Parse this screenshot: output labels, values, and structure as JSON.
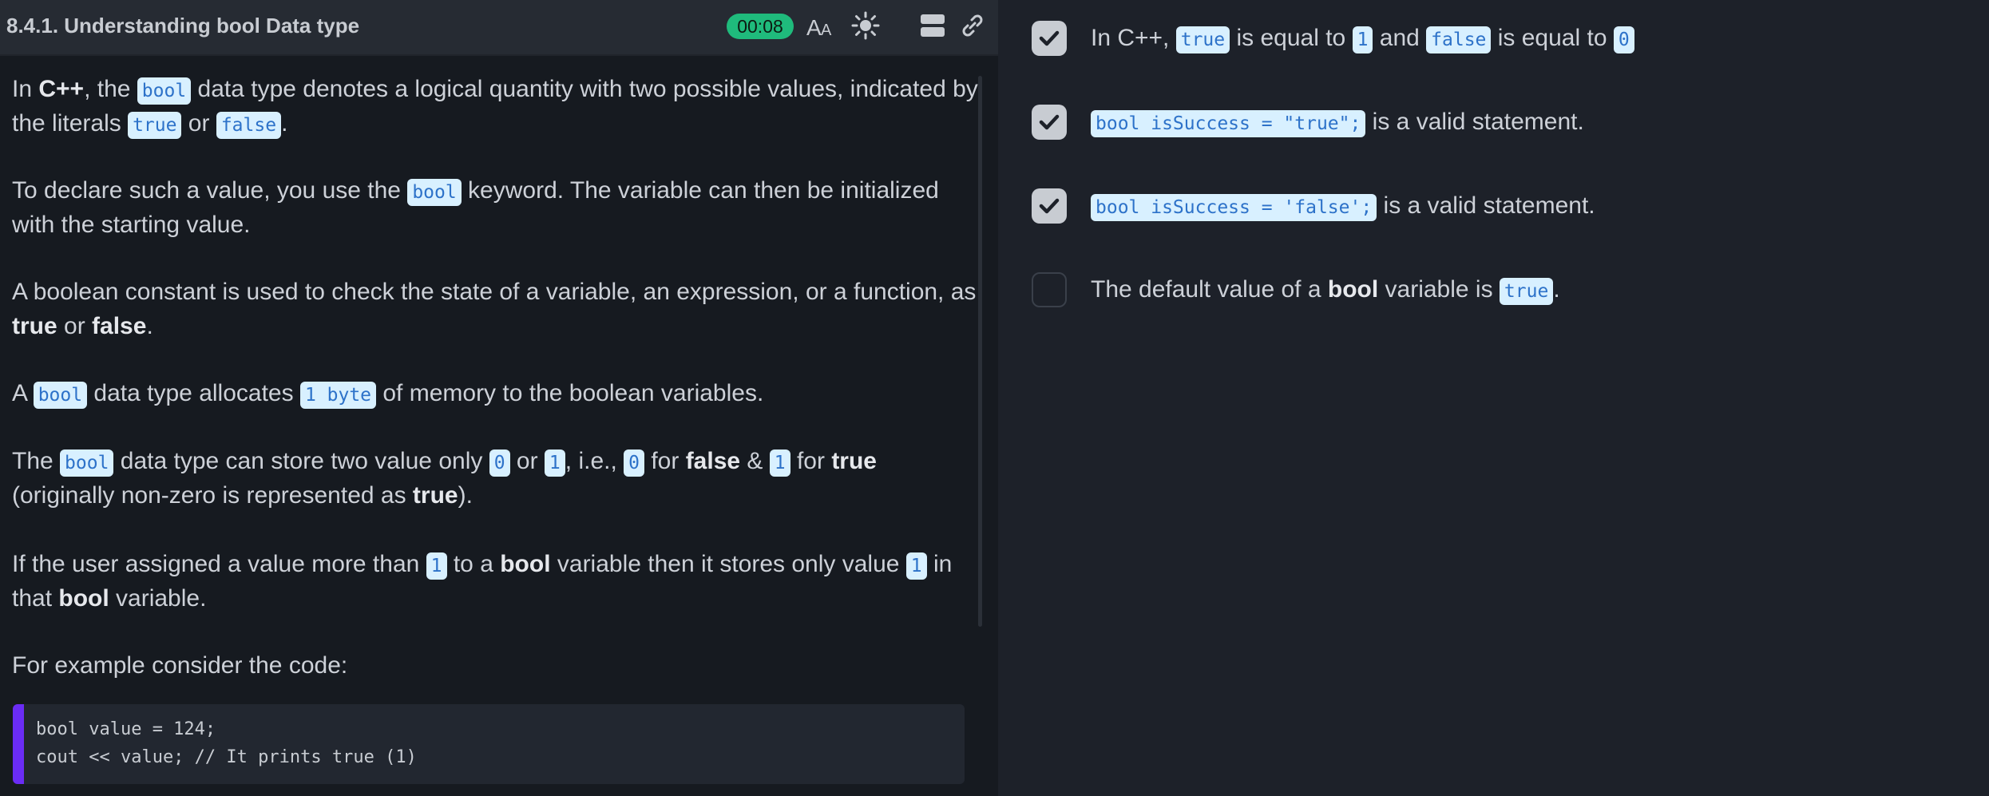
{
  "header": {
    "title": "8.4.1. Understanding bool Data type",
    "timer": "00:08",
    "icons": [
      "font-size-icon",
      "theme-icon",
      "layout-icon",
      "link-icon"
    ]
  },
  "content": {
    "p1": {
      "t1": "In ",
      "b1": "C++",
      "t2": ", the ",
      "c1": "bool",
      "t3": " data type denotes a logical quantity with two possible values, indicated by the literals ",
      "c2": "true",
      "t4": " or ",
      "c3": "false",
      "t5": "."
    },
    "p2": {
      "t1": "To declare such a value, you use the ",
      "c1": "bool",
      "t2": " keyword. The variable can then be initialized with the starting value."
    },
    "p3": {
      "t1": "A boolean constant is used to check the state of a variable, an expression, or a function, as ",
      "b1": "true",
      "t2": " or ",
      "b2": "false",
      "t3": "."
    },
    "p4": {
      "t1": "A ",
      "c1": "bool",
      "t2": " data type allocates ",
      "c2": "1 byte",
      "t3": " of memory to the boolean variables."
    },
    "p5": {
      "t1": "The ",
      "c1": "bool",
      "t2": " data type can store two value only ",
      "c2": "0",
      "t3": " or ",
      "c3": "1",
      "t4": ", i.e., ",
      "c4": "0",
      "t5": " for ",
      "b1": "false",
      "t6": " & ",
      "c5": "1",
      "t7": " for ",
      "b2": "true",
      "t8": " (originally non-zero is represented as ",
      "b3": "true",
      "t9": ")."
    },
    "p6": {
      "t1": "If the user assigned a value more than ",
      "c1": "1",
      "t2": " to a ",
      "b1": "bool",
      "t3": " variable then it stores only value ",
      "c2": "1",
      "t4": " in that ",
      "b2": "bool",
      "t5": " variable."
    },
    "p7": "For example consider the code:",
    "code": [
      "bool value = 124;",
      "cout << value; // It prints true (1)"
    ]
  },
  "options": [
    {
      "checked": true,
      "t1": "In C++, ",
      "c1": "true",
      "t2": " is equal to ",
      "c2": "1",
      "t3": " and ",
      "c3": "false",
      "t4": " is equal to ",
      "c4": "0"
    },
    {
      "checked": true,
      "c1": "bool isSuccess = \"true\";",
      "t1": " is a valid statement."
    },
    {
      "checked": true,
      "c1": "bool isSuccess = 'false';",
      "t1": " is a valid statement."
    },
    {
      "checked": false,
      "t1": "The default value of a ",
      "b1": "bool",
      "t2": " variable is ",
      "c1": "true",
      "t3": "."
    }
  ],
  "colors": {
    "accent": "#1fbb7c",
    "code_bar": "#6a2cf5",
    "inline_code_bg": "#d8f0ff",
    "inline_code_fg": "#2d72c9"
  }
}
